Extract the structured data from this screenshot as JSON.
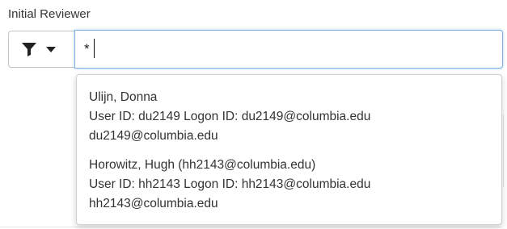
{
  "field": {
    "label": "Initial Reviewer",
    "input_value": "*"
  },
  "filter": {
    "icon": "filter-icon",
    "caret_icon": "caret-down-icon"
  },
  "results": [
    {
      "name": "Ulijn, Donna",
      "ids": "User ID: du2149 Logon ID: du2149@columbia.edu",
      "email": "du2149@columbia.edu"
    },
    {
      "name": "Horowitz, Hugh (hh2143@columbia.edu)",
      "ids": "User ID: hh2143 Logon ID: hh2143@columbia.edu",
      "email": "hh2143@columbia.edu"
    }
  ]
}
